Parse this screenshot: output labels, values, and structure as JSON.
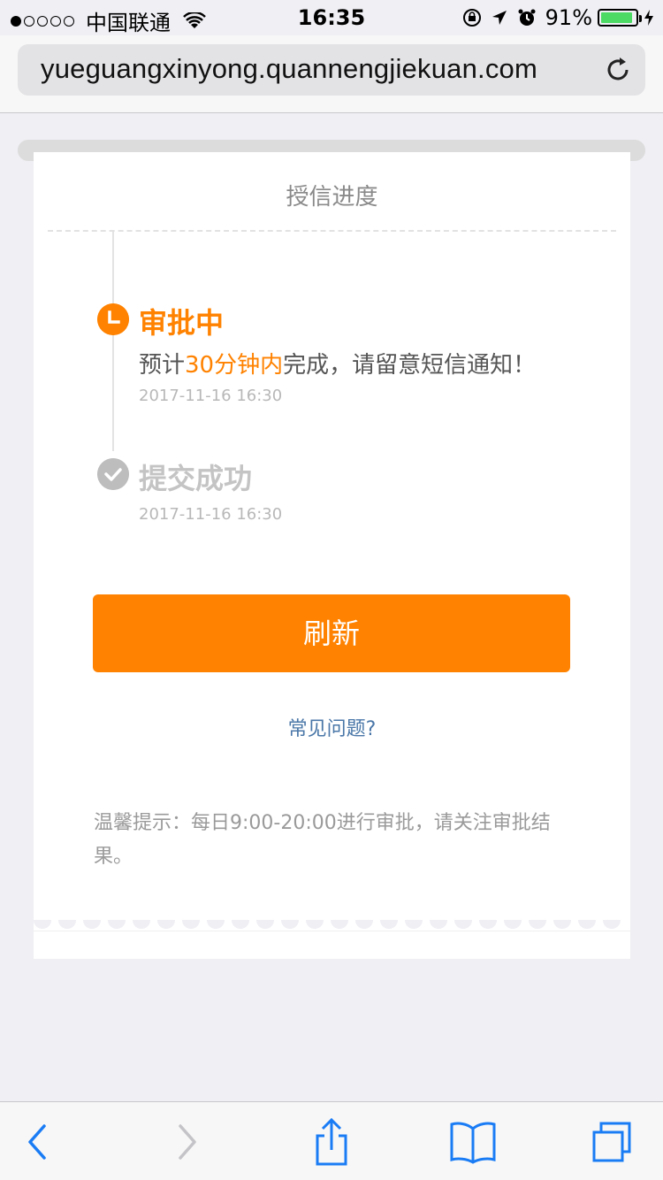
{
  "status_bar": {
    "carrier": "中国联通",
    "time": "16:35",
    "battery_percent": "91%",
    "battery_level": 0.91,
    "icons": [
      "signal-dots",
      "wifi-icon",
      "rotation-lock-icon",
      "location-icon",
      "alarm-icon",
      "battery-icon",
      "charging-icon"
    ]
  },
  "browser": {
    "url": "yueguangxinyong.quannengjiekuan.com",
    "reload_icon": "reload-icon"
  },
  "card": {
    "title": "授信进度",
    "steps": [
      {
        "title": "审批中",
        "desc_before": "预计",
        "desc_highlight": "30分钟内",
        "desc_after": "完成，请留意短信通知！",
        "time": "2017-11-16 16:30",
        "icon": "clock-icon",
        "state": "active"
      },
      {
        "title": "提交成功",
        "time": "2017-11-16 16:30",
        "icon": "check-circle-icon",
        "state": "done"
      }
    ],
    "refresh_label": "刷新",
    "faq_label": "常见问题?",
    "tip": "温馨提示：每日9:00-20:00进行审批，请关注审批结果。"
  },
  "toolbar": {
    "items": [
      "back-icon",
      "forward-icon",
      "share-icon",
      "bookmarks-icon",
      "tabs-icon"
    ]
  },
  "colors": {
    "accent": "#ff8200",
    "link": "#4a77a8",
    "muted": "#b8b8b8"
  }
}
